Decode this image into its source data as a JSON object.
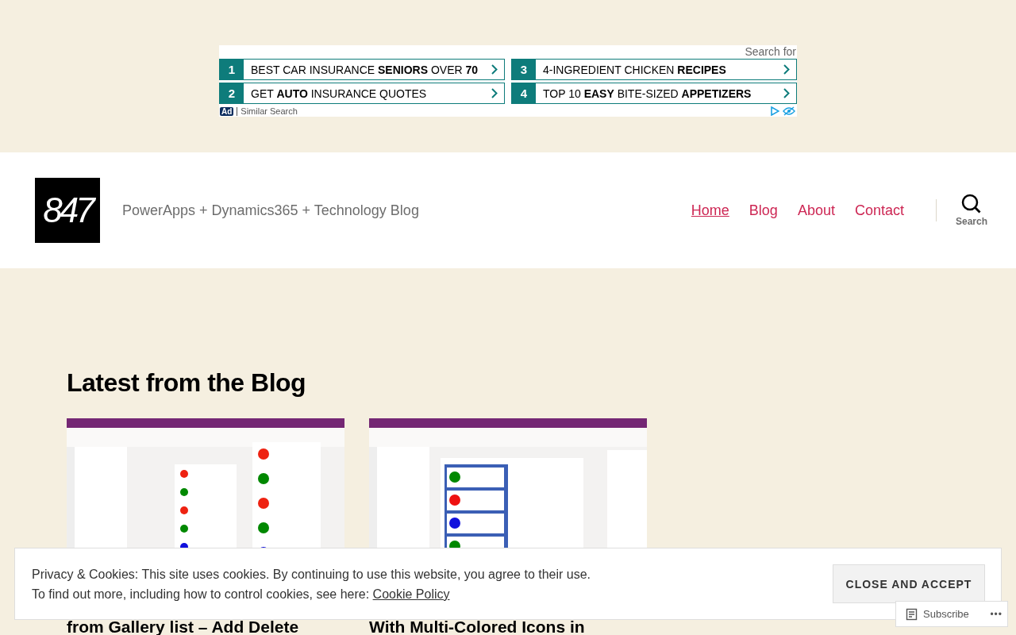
{
  "ad": {
    "search_for": "Search for",
    "results": [
      {
        "number": "1",
        "text": "BEST CAR INSURANCE **SENIORS** OVER **70**"
      },
      {
        "number": "3",
        "text": "4-INGREDIENT CHICKEN **RECIPES**"
      },
      {
        "number": "2",
        "text": "GET **AUTO** INSURANCE QUOTES"
      },
      {
        "number": "4",
        "text": "TOP 10 **EASY** BITE-SIZED **APPETIZERS**"
      }
    ],
    "badge": "Ad",
    "footer": "Similar Search"
  },
  "header": {
    "logo": "847",
    "tagline": "PowerApps + Dynamics365 + Technology Blog",
    "nav": [
      {
        "label": "Home",
        "selected": true
      },
      {
        "label": "Blog",
        "selected": false
      },
      {
        "label": "About",
        "selected": false
      },
      {
        "label": "Contact",
        "selected": false
      }
    ],
    "search_label": "Search"
  },
  "section_title": "Latest from the Blog",
  "posts": [
    {
      "title_visible": "from Gallery list – Add Delete"
    },
    {
      "title_visible": "With Multi-Colored Icons in"
    }
  ],
  "cookie_banner": {
    "line_1": "Privacy & Cookies: This site uses cookies. By continuing to use this website, you agree to their use.",
    "line_2": "To find out more, including how to control cookies, see here:",
    "link": "Cookie Policy",
    "button": "CLOSE AND ACCEPT"
  },
  "subscribe": {
    "label": "Subscribe",
    "more": "•••"
  }
}
